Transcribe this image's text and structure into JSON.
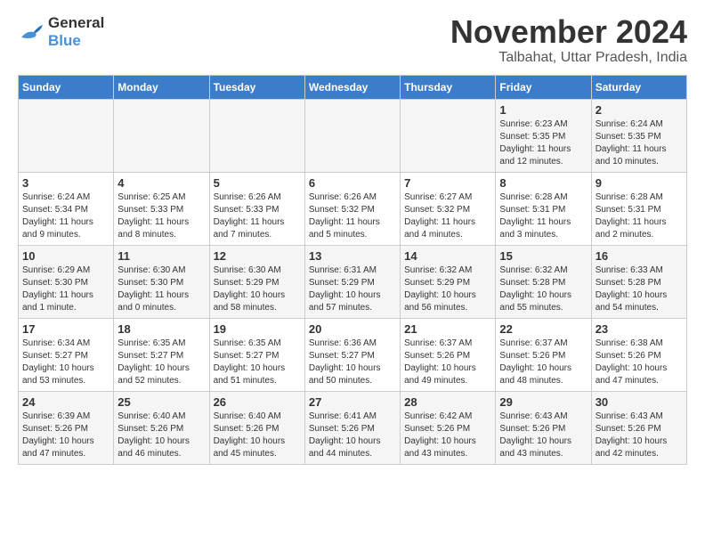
{
  "logo": {
    "line1": "General",
    "line2": "Blue"
  },
  "title": "November 2024",
  "subtitle": "Talbahat, Uttar Pradesh, India",
  "weekdays": [
    "Sunday",
    "Monday",
    "Tuesday",
    "Wednesday",
    "Thursday",
    "Friday",
    "Saturday"
  ],
  "weeks": [
    [
      {
        "day": "",
        "info": ""
      },
      {
        "day": "",
        "info": ""
      },
      {
        "day": "",
        "info": ""
      },
      {
        "day": "",
        "info": ""
      },
      {
        "day": "",
        "info": ""
      },
      {
        "day": "1",
        "info": "Sunrise: 6:23 AM\nSunset: 5:35 PM\nDaylight: 11 hours and 12 minutes."
      },
      {
        "day": "2",
        "info": "Sunrise: 6:24 AM\nSunset: 5:35 PM\nDaylight: 11 hours and 10 minutes."
      }
    ],
    [
      {
        "day": "3",
        "info": "Sunrise: 6:24 AM\nSunset: 5:34 PM\nDaylight: 11 hours and 9 minutes."
      },
      {
        "day": "4",
        "info": "Sunrise: 6:25 AM\nSunset: 5:33 PM\nDaylight: 11 hours and 8 minutes."
      },
      {
        "day": "5",
        "info": "Sunrise: 6:26 AM\nSunset: 5:33 PM\nDaylight: 11 hours and 7 minutes."
      },
      {
        "day": "6",
        "info": "Sunrise: 6:26 AM\nSunset: 5:32 PM\nDaylight: 11 hours and 5 minutes."
      },
      {
        "day": "7",
        "info": "Sunrise: 6:27 AM\nSunset: 5:32 PM\nDaylight: 11 hours and 4 minutes."
      },
      {
        "day": "8",
        "info": "Sunrise: 6:28 AM\nSunset: 5:31 PM\nDaylight: 11 hours and 3 minutes."
      },
      {
        "day": "9",
        "info": "Sunrise: 6:28 AM\nSunset: 5:31 PM\nDaylight: 11 hours and 2 minutes."
      }
    ],
    [
      {
        "day": "10",
        "info": "Sunrise: 6:29 AM\nSunset: 5:30 PM\nDaylight: 11 hours and 1 minute."
      },
      {
        "day": "11",
        "info": "Sunrise: 6:30 AM\nSunset: 5:30 PM\nDaylight: 11 hours and 0 minutes."
      },
      {
        "day": "12",
        "info": "Sunrise: 6:30 AM\nSunset: 5:29 PM\nDaylight: 10 hours and 58 minutes."
      },
      {
        "day": "13",
        "info": "Sunrise: 6:31 AM\nSunset: 5:29 PM\nDaylight: 10 hours and 57 minutes."
      },
      {
        "day": "14",
        "info": "Sunrise: 6:32 AM\nSunset: 5:29 PM\nDaylight: 10 hours and 56 minutes."
      },
      {
        "day": "15",
        "info": "Sunrise: 6:32 AM\nSunset: 5:28 PM\nDaylight: 10 hours and 55 minutes."
      },
      {
        "day": "16",
        "info": "Sunrise: 6:33 AM\nSunset: 5:28 PM\nDaylight: 10 hours and 54 minutes."
      }
    ],
    [
      {
        "day": "17",
        "info": "Sunrise: 6:34 AM\nSunset: 5:27 PM\nDaylight: 10 hours and 53 minutes."
      },
      {
        "day": "18",
        "info": "Sunrise: 6:35 AM\nSunset: 5:27 PM\nDaylight: 10 hours and 52 minutes."
      },
      {
        "day": "19",
        "info": "Sunrise: 6:35 AM\nSunset: 5:27 PM\nDaylight: 10 hours and 51 minutes."
      },
      {
        "day": "20",
        "info": "Sunrise: 6:36 AM\nSunset: 5:27 PM\nDaylight: 10 hours and 50 minutes."
      },
      {
        "day": "21",
        "info": "Sunrise: 6:37 AM\nSunset: 5:26 PM\nDaylight: 10 hours and 49 minutes."
      },
      {
        "day": "22",
        "info": "Sunrise: 6:37 AM\nSunset: 5:26 PM\nDaylight: 10 hours and 48 minutes."
      },
      {
        "day": "23",
        "info": "Sunrise: 6:38 AM\nSunset: 5:26 PM\nDaylight: 10 hours and 47 minutes."
      }
    ],
    [
      {
        "day": "24",
        "info": "Sunrise: 6:39 AM\nSunset: 5:26 PM\nDaylight: 10 hours and 47 minutes."
      },
      {
        "day": "25",
        "info": "Sunrise: 6:40 AM\nSunset: 5:26 PM\nDaylight: 10 hours and 46 minutes."
      },
      {
        "day": "26",
        "info": "Sunrise: 6:40 AM\nSunset: 5:26 PM\nDaylight: 10 hours and 45 minutes."
      },
      {
        "day": "27",
        "info": "Sunrise: 6:41 AM\nSunset: 5:26 PM\nDaylight: 10 hours and 44 minutes."
      },
      {
        "day": "28",
        "info": "Sunrise: 6:42 AM\nSunset: 5:26 PM\nDaylight: 10 hours and 43 minutes."
      },
      {
        "day": "29",
        "info": "Sunrise: 6:43 AM\nSunset: 5:26 PM\nDaylight: 10 hours and 43 minutes."
      },
      {
        "day": "30",
        "info": "Sunrise: 6:43 AM\nSunset: 5:26 PM\nDaylight: 10 hours and 42 minutes."
      }
    ]
  ]
}
